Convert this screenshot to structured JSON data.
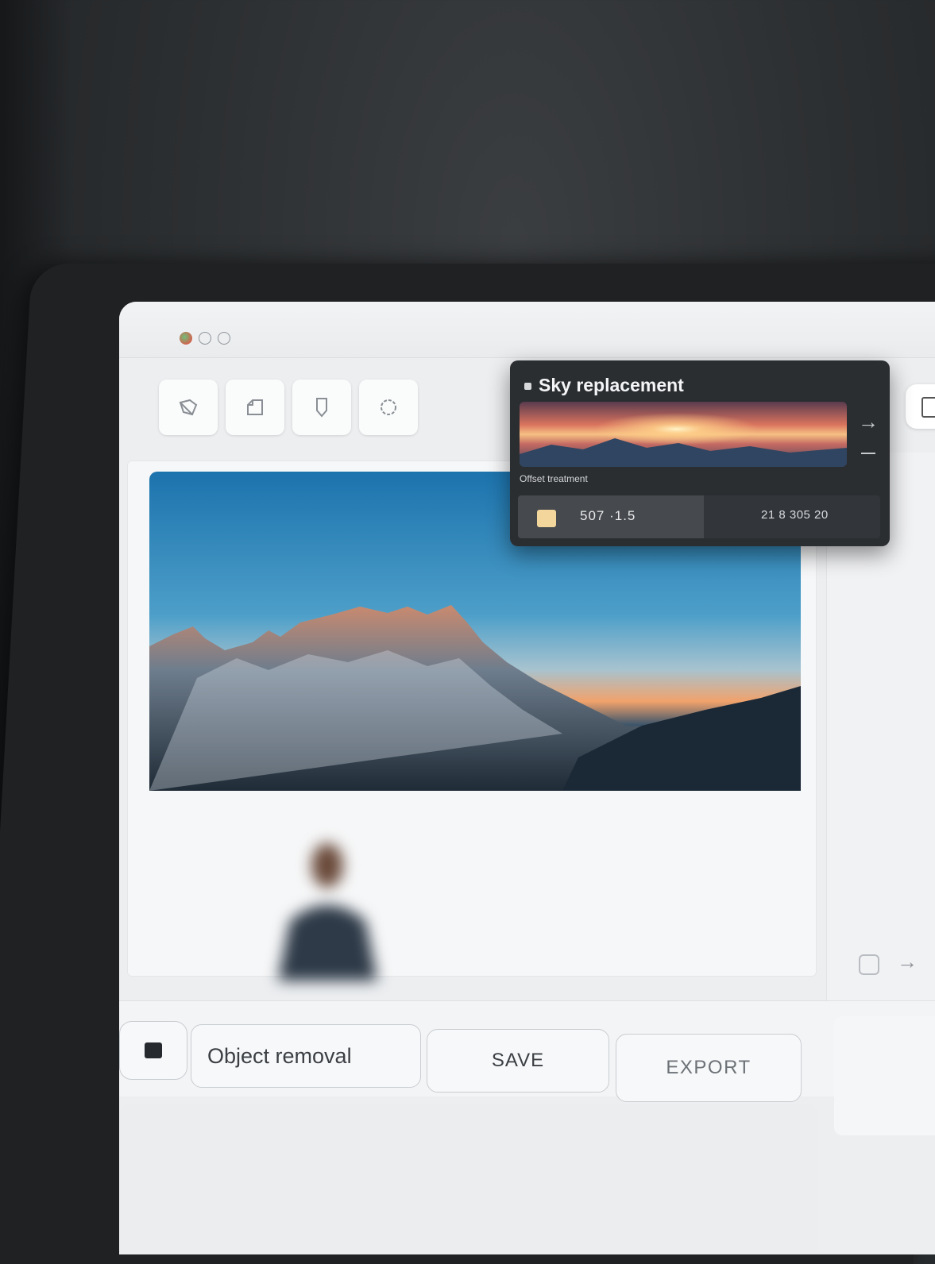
{
  "window": {
    "controls": [
      "close",
      "minimize",
      "maximize"
    ]
  },
  "toolbar": {
    "tools": [
      {
        "name": "lasso-select",
        "icon": "lasso-icon"
      },
      {
        "name": "page-select",
        "icon": "page-icon"
      },
      {
        "name": "mask-select",
        "icon": "mask-icon"
      },
      {
        "name": "circle-select",
        "icon": "circle-icon"
      }
    ]
  },
  "sky_panel": {
    "title": "Sky replacement",
    "caption": "Offset treatment",
    "value_left": "507 ·1.5",
    "value_right": "21 8 305 20",
    "swatch_color": "#f3d69b"
  },
  "bottom_bar": {
    "mode_label": "Object removal",
    "save_label": "SAVE",
    "export_label": "EXPORT"
  },
  "colors": {
    "popup_bg": "#2b2e31",
    "screen_bg": "#eceef0",
    "sky_top": "#1f6fa3",
    "sky_horizon": "#f1a26b"
  }
}
